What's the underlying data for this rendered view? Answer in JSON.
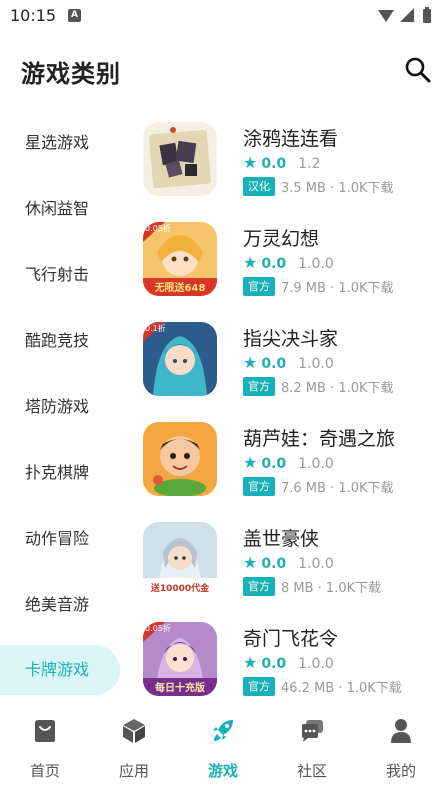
{
  "status_bar": {
    "time": "10:15",
    "notif_glyph": "A"
  },
  "header": {
    "title": "游戏类别"
  },
  "sidebar": {
    "items": [
      {
        "label": "星选游戏"
      },
      {
        "label": "休闲益智"
      },
      {
        "label": "飞行射击"
      },
      {
        "label": "酷跑竞技"
      },
      {
        "label": "塔防游戏"
      },
      {
        "label": "扑克棋牌"
      },
      {
        "label": "动作冒险"
      },
      {
        "label": "绝美音游"
      },
      {
        "label": "卡牌游戏",
        "active": true
      }
    ]
  },
  "games": [
    {
      "name": "涂鸦连连看",
      "rating": "0.0",
      "version": "1.2",
      "badge": "汉化",
      "meta": "3.5 MB · 1.0K下载",
      "icon": "doodle-icon",
      "icon_text": ""
    },
    {
      "name": "万灵幻想",
      "rating": "0.0",
      "version": "1.0.0",
      "badge": "官方",
      "meta": "7.9 MB · 1.0K下载",
      "icon": "anime-girl-icon",
      "icon_text": "无限送648",
      "corner": "0.05折"
    },
    {
      "name": "指尖决斗家",
      "rating": "0.0",
      "version": "1.0.0",
      "badge": "官方",
      "meta": "8.2 MB · 1.0K下载",
      "icon": "duel-girl-icon",
      "icon_text": "",
      "corner": "0.1折"
    },
    {
      "name": "葫芦娃：奇遇之旅",
      "rating": "0.0",
      "version": "1.0.0",
      "badge": "官方",
      "meta": "7.6 MB · 1.0K下载",
      "icon": "calabash-boy-icon",
      "icon_text": ""
    },
    {
      "name": "盖世豪侠",
      "rating": "0.0",
      "version": "1.0.0",
      "badge": "官方",
      "meta": "8 MB · 1.0K下载",
      "icon": "hero-icon",
      "icon_text": "送10000代金"
    },
    {
      "name": "奇门飞花令",
      "rating": "0.0",
      "version": "1.0.0",
      "badge": "官方",
      "meta": "46.2 MB · 1.0K下载",
      "icon": "flower-girl-icon",
      "icon_text": "每日十充版",
      "corner": "0.05折"
    }
  ],
  "bottom_nav": {
    "items": [
      {
        "label": "首页",
        "icon": "home-icon"
      },
      {
        "label": "应用",
        "icon": "cube-icon"
      },
      {
        "label": "游戏",
        "icon": "rocket-icon",
        "active": true
      },
      {
        "label": "社区",
        "icon": "chat-icon"
      },
      {
        "label": "我的",
        "icon": "person-icon"
      }
    ]
  },
  "colors": {
    "accent": "#19b1b9",
    "active_bg": "#d9f5f5",
    "text": "#222222",
    "muted": "#999999"
  }
}
